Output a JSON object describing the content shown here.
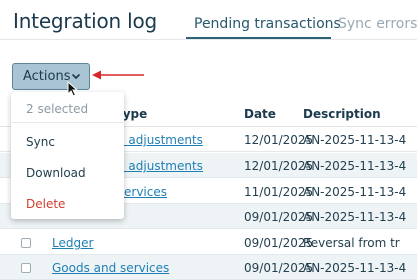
{
  "header": {
    "title": "Integration log"
  },
  "tabs": [
    {
      "label": "Pending transactions",
      "active": true
    },
    {
      "label": "Sync errors",
      "active": false
    }
  ],
  "toolbar": {
    "actions_label": "Actions"
  },
  "actions_menu": {
    "status": "2 selected",
    "items": [
      {
        "label": "Sync"
      },
      {
        "label": "Download"
      },
      {
        "label": "Delete"
      }
    ]
  },
  "table": {
    "headers": {
      "type": "type",
      "date": "Date",
      "description": "Description"
    },
    "rows": [
      {
        "type": "d adjustments",
        "date": "12/01/2025",
        "description": "AN-2025-11-13-4"
      },
      {
        "type": "d adjustments",
        "date": "12/01/2025",
        "description": "AN-2025-11-13-4"
      },
      {
        "type": "ervices",
        "date": "11/01/2025",
        "description": "AN-2025-11-13-4"
      },
      {
        "type": "",
        "date": "09/01/2025",
        "description": "AN-2025-11-13-4"
      },
      {
        "type": "Ledger",
        "date": "09/01/2025",
        "description": "Reversal from tr"
      },
      {
        "type": "Goods and services",
        "date": "09/01/2025",
        "description": "AN-2025-11-13-4"
      }
    ]
  },
  "colors": {
    "accent": "#2f6277",
    "button_bg": "#a9c4d2",
    "link": "#1f7fb3",
    "danger": "#d1402f",
    "annotation_arrow": "#d9262a"
  }
}
